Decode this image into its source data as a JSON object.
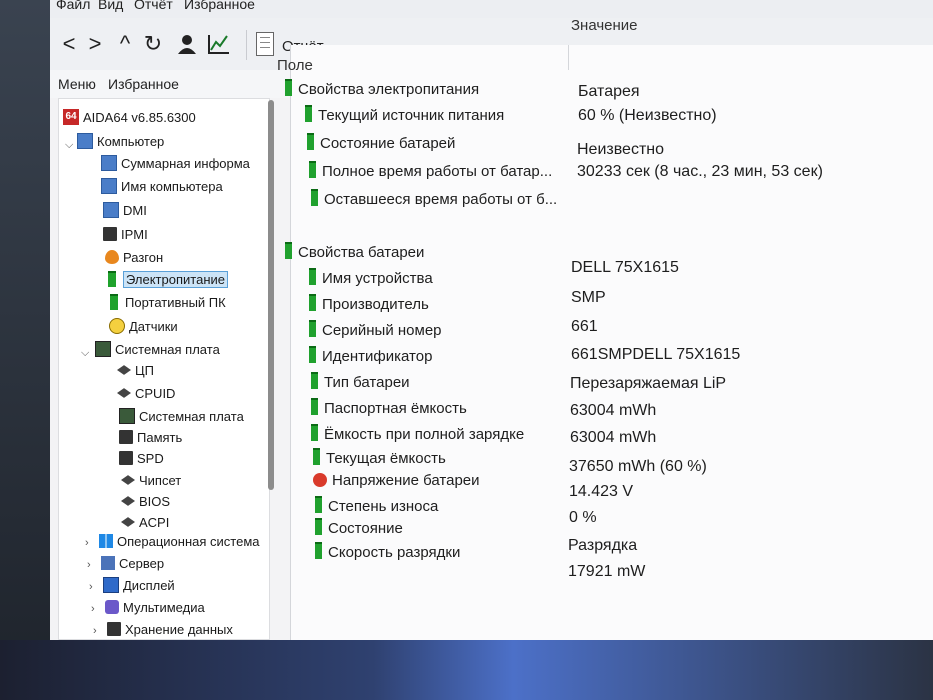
{
  "menubar": [
    "Файл",
    "Вид",
    "Отчёт",
    "Избранное"
  ],
  "toolbar": {
    "back_icon": "<",
    "forward_icon": ">",
    "up_icon": "^",
    "refresh_icon": "↻",
    "user_icon": "user-icon",
    "chart_icon": "chart-icon",
    "report_label": "Отчёт"
  },
  "left_tabs": {
    "menu": "Меню",
    "favorites": "Избранное"
  },
  "tree": {
    "root": {
      "badge": "64",
      "label": "AIDA64 v6.85.6300"
    },
    "items": [
      {
        "label": "Компьютер"
      },
      {
        "label": "Суммарная информа"
      },
      {
        "label": "Имя компьютера"
      },
      {
        "label": "DMI"
      },
      {
        "label": "IPMI"
      },
      {
        "label": "Разгон"
      },
      {
        "label": "Электропитание"
      },
      {
        "label": "Портативный ПК"
      },
      {
        "label": "Датчики"
      },
      {
        "label": "Системная плата"
      },
      {
        "label": "ЦП"
      },
      {
        "label": "CPUID"
      },
      {
        "label": "Системная плата"
      },
      {
        "label": "Память"
      },
      {
        "label": "SPD"
      },
      {
        "label": "Чипсет"
      },
      {
        "label": "BIOS"
      },
      {
        "label": "ACPI"
      },
      {
        "label": "Операционная система"
      },
      {
        "label": "Сервер"
      },
      {
        "label": "Дисплей"
      },
      {
        "label": "Мультимедиа"
      },
      {
        "label": "Хранение данных"
      }
    ]
  },
  "columns": {
    "field": "Поле",
    "value": "Значение"
  },
  "sections": [
    {
      "title": "Свойства электропитания",
      "rows": [
        {
          "field": "Текущий источник питания",
          "value": "Батарея"
        },
        {
          "field": "Состояние батарей",
          "value": "60 % (Неизвестно)"
        },
        {
          "field": "Полное время работы от батар...",
          "value": "Неизвестно"
        },
        {
          "field": "Оставшееся время работы от б...",
          "value": "30233 сек (8 час., 23 мин, 53 сек)"
        }
      ]
    },
    {
      "title": "Свойства батареи",
      "rows": [
        {
          "field": "Имя устройства",
          "value": "DELL 75X1615"
        },
        {
          "field": "Производитель",
          "value": "SMP"
        },
        {
          "field": "Серийный номер",
          "value": "661"
        },
        {
          "field": "Идентификатор",
          "value": "661SMPDELL 75X1615"
        },
        {
          "field": "Тип батареи",
          "value": "Перезаряжаемая LiP"
        },
        {
          "field": "Паспортная ёмкость",
          "value": "63004 mWh"
        },
        {
          "field": "Ёмкость при полной зарядке",
          "value": "63004 mWh"
        },
        {
          "field": "Текущая ёмкость",
          "value": "37650 mWh  (60 %)"
        },
        {
          "field": "Напряжение батареи",
          "value": "14.423 V"
        },
        {
          "field": "Степень износа",
          "value": "0 %"
        },
        {
          "field": "Состояние",
          "value": "Разрядка"
        },
        {
          "field": "Скорость разрядки",
          "value": "17921 mW"
        }
      ]
    }
  ]
}
